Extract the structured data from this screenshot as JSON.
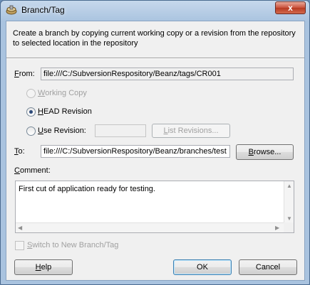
{
  "window": {
    "title": "Branch/Tag",
    "close_glyph": "x"
  },
  "description": "Create a branch by copying current working copy or a revision from the repository to selected location in the repository",
  "from": {
    "label_u": "F",
    "label_rest": "rom:",
    "value": "file:///C:/SubversionRespository/Beanz/tags/CR001"
  },
  "source": {
    "working_copy": {
      "label_u": "W",
      "label_rest": "orking Copy",
      "enabled": false,
      "selected": false
    },
    "head_revision": {
      "label_u": "H",
      "label_rest": "EAD Revision",
      "enabled": true,
      "selected": true
    },
    "use_revision": {
      "label_u": "U",
      "label_rest": "se Revision:",
      "enabled": true,
      "selected": false,
      "value": ""
    },
    "list_revisions_button": {
      "label_u": "L",
      "label_rest": "ist Revisions..."
    }
  },
  "to": {
    "label_u": "T",
    "label_rest": "o:",
    "value": "file:///C:/SubversionRespository/Beanz/branches/test"
  },
  "browse_button": {
    "label_u": "B",
    "label_rest": "rowse..."
  },
  "comment": {
    "label_u": "C",
    "label_rest": "omment:",
    "value": "First cut of application ready for testing."
  },
  "switch_checkbox": {
    "label_u": "S",
    "label_rest": "witch to New Branch/Tag",
    "checked": false,
    "enabled": false
  },
  "buttons": {
    "help": {
      "label_u": "H",
      "label_rest": "elp"
    },
    "ok": {
      "label": "OK"
    },
    "cancel": {
      "label": "Cancel"
    }
  },
  "icons": {
    "app": "svn-icon",
    "close": "close-icon"
  }
}
